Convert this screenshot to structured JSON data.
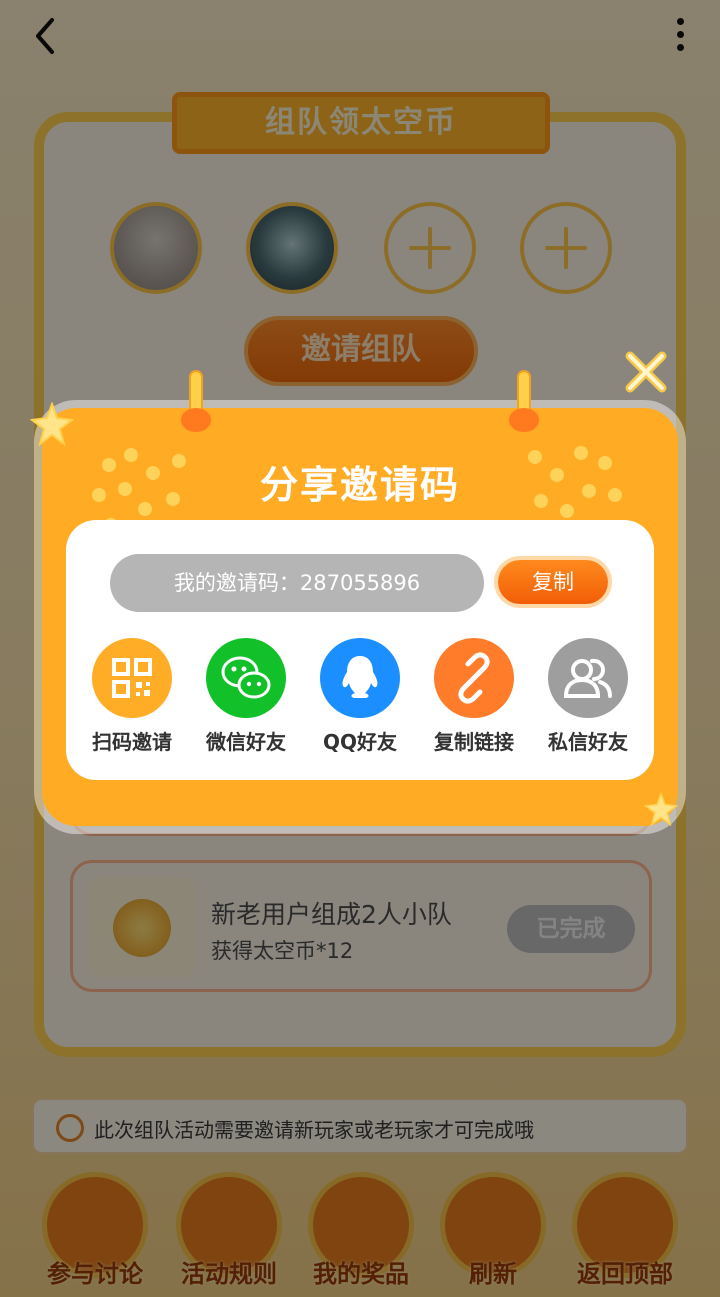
{
  "page": {
    "card_title": "组队领太空币",
    "invite_team_button": "邀请组队",
    "task": {
      "title": "新老用户组成2人小队",
      "reward": "获得太空币*12",
      "status": "已完成"
    },
    "notice": "此次组队活动需要邀请新玩家或老玩家才可完成哦",
    "bottom_nav": [
      {
        "label": "参与讨论",
        "icon": "chat-icon"
      },
      {
        "label": "活动规则",
        "icon": "star-icon"
      },
      {
        "label": "我的奖品",
        "icon": "gift-icon"
      },
      {
        "label": "刷新",
        "icon": "refresh-icon"
      },
      {
        "label": "返回顶部",
        "icon": "upload-icon"
      }
    ]
  },
  "modal": {
    "title": "分享邀请码",
    "invite_code_label": "我的邀请码：287055896",
    "copy_button": "复制",
    "share_options": [
      {
        "label": "扫码邀请",
        "icon": "qrcode-icon",
        "color": "#ffad26"
      },
      {
        "label": "微信好友",
        "icon": "wechat-icon",
        "color": "#12c12a"
      },
      {
        "label": "QQ好友",
        "icon": "qq-icon",
        "color": "#1b8fff"
      },
      {
        "label": "复制链接",
        "icon": "link-icon",
        "color": "#ff7c2a"
      },
      {
        "label": "私信好友",
        "icon": "users-icon",
        "color": "#9e9e9e"
      }
    ]
  },
  "colors": {
    "modal_bg": "#ffab24",
    "accent_orange": "#f25d06",
    "pill_gray": "#b5b5b5"
  }
}
